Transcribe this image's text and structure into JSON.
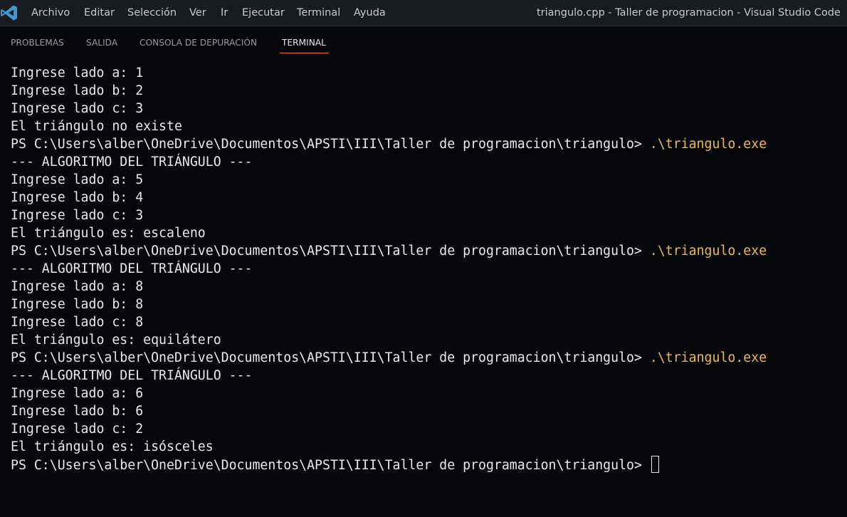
{
  "titlebar": {
    "menu": [
      "Archivo",
      "Editar",
      "Selección",
      "Ver",
      "Ir",
      "Ejecutar",
      "Terminal",
      "Ayuda"
    ],
    "window_title": "triangulo.cpp - Taller de programacion - Visual Studio Code",
    "logo_icon": "vscode-logo-icon",
    "logo_color": "#3c99d4"
  },
  "panel": {
    "tabs": [
      "PROBLEMAS",
      "SALIDA",
      "CONSOLA DE DEPURACIÓN",
      "TERMINAL"
    ],
    "active_tab": "TERMINAL",
    "accent_color": "#e8702a"
  },
  "terminal": {
    "prompt": "PS C:\\Users\\alber\\OneDrive\\Documentos\\APSTI\\III\\Taller de programacion\\triangulo> ",
    "command_color": "#f0b94d",
    "lines": [
      {
        "text": "Ingrese lado a: 1"
      },
      {
        "text": "Ingrese lado b: 2"
      },
      {
        "text": "Ingrese lado c: 3"
      },
      {
        "text": "El triángulo no existe"
      },
      {
        "text": "PS C:\\Users\\alber\\OneDrive\\Documentos\\APSTI\\III\\Taller de programacion\\triangulo> ",
        "command": ".\\triangulo.exe"
      },
      {
        "text": "--- ALGORITMO DEL TRIÁNGULO ---"
      },
      {
        "text": "Ingrese lado a: 5"
      },
      {
        "text": "Ingrese lado b: 4"
      },
      {
        "text": "Ingrese lado c: 3"
      },
      {
        "text": "El triángulo es: escaleno"
      },
      {
        "text": "PS C:\\Users\\alber\\OneDrive\\Documentos\\APSTI\\III\\Taller de programacion\\triangulo> ",
        "command": ".\\triangulo.exe"
      },
      {
        "text": "--- ALGORITMO DEL TRIÁNGULO ---"
      },
      {
        "text": "Ingrese lado a: 8"
      },
      {
        "text": "Ingrese lado b: 8"
      },
      {
        "text": "Ingrese lado c: 8"
      },
      {
        "text": "El triángulo es: equilátero"
      },
      {
        "text": "PS C:\\Users\\alber\\OneDrive\\Documentos\\APSTI\\III\\Taller de programacion\\triangulo> ",
        "command": ".\\triangulo.exe"
      },
      {
        "text": "--- ALGORITMO DEL TRIÁNGULO ---"
      },
      {
        "text": "Ingrese lado a: 6"
      },
      {
        "text": "Ingrese lado b: 6"
      },
      {
        "text": "Ingrese lado c: 2"
      },
      {
        "text": "El triángulo es: isósceles"
      },
      {
        "text": "PS C:\\Users\\alber\\OneDrive\\Documentos\\APSTI\\III\\Taller de programacion\\triangulo> ",
        "cursor": true
      }
    ]
  }
}
